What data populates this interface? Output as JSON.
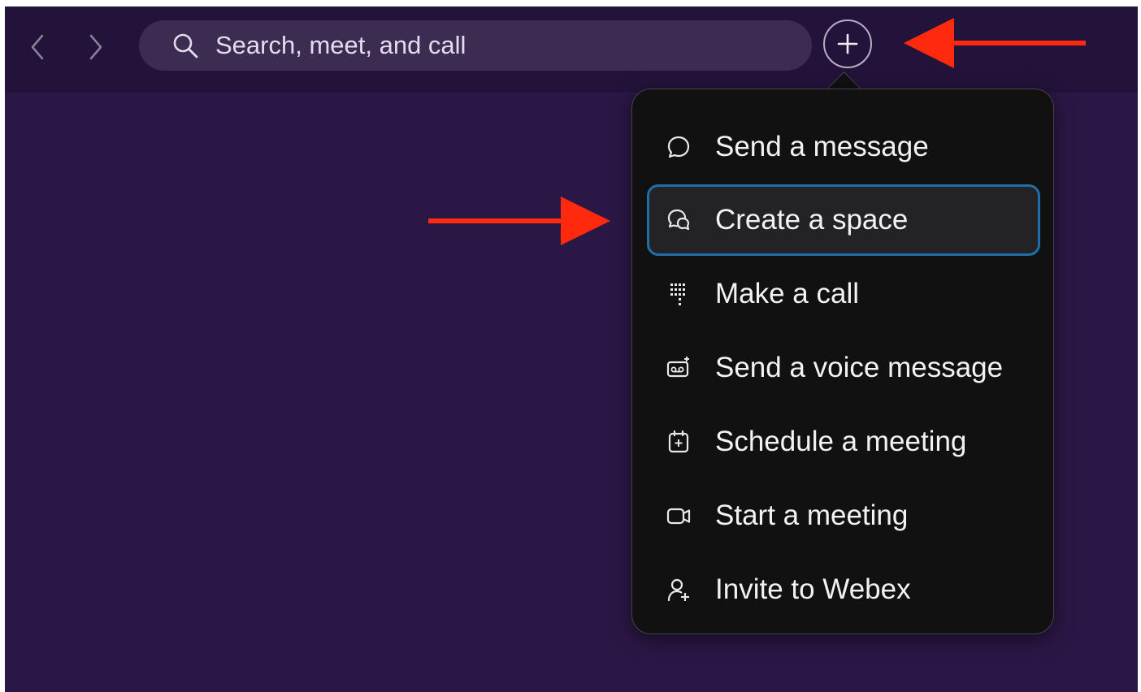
{
  "search": {
    "placeholder": "Search, meet, and call"
  },
  "menu": {
    "items": [
      {
        "label": "Send a message",
        "icon": "chat-bubble-icon"
      },
      {
        "label": "Create a space",
        "icon": "space-icon",
        "selected": true
      },
      {
        "label": "Make a call",
        "icon": "dialpad-icon"
      },
      {
        "label": "Send a voice message",
        "icon": "voicemail-icon"
      },
      {
        "label": "Schedule a meeting",
        "icon": "calendar-add-icon"
      },
      {
        "label": "Start a meeting",
        "icon": "video-icon"
      },
      {
        "label": "Invite to Webex",
        "icon": "invite-user-icon"
      }
    ]
  },
  "colors": {
    "app_bg": "#2b1745",
    "topbar_bg": "#23133a",
    "menu_bg": "#111112",
    "selection_border": "#1e6fa8",
    "annotation_arrow": "#ff2a0d"
  }
}
